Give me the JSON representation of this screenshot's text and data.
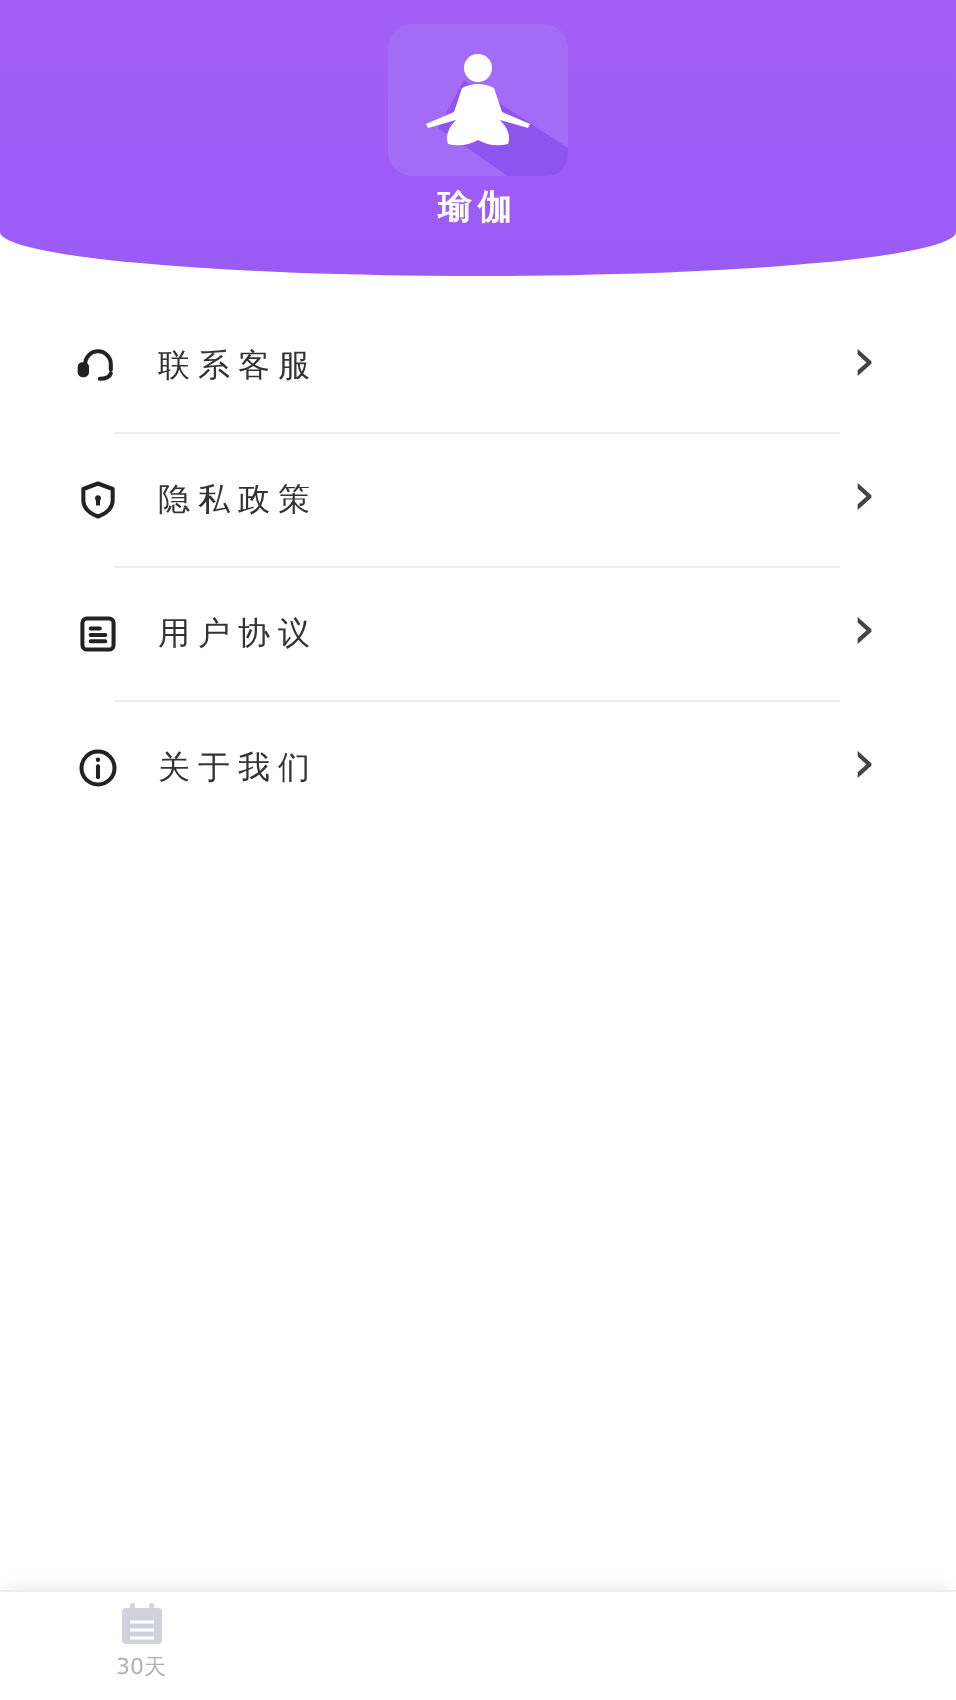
{
  "header": {
    "app_name": "瑜伽"
  },
  "menu": [
    {
      "kind": "headset",
      "label": "联系客服",
      "chevron": "›"
    },
    {
      "kind": "shield",
      "label": "隐私政策",
      "chevron": "›"
    },
    {
      "kind": "document",
      "label": "用户协议",
      "chevron": "›"
    },
    {
      "kind": "info",
      "label": "关于我们",
      "chevron": "›"
    }
  ],
  "tab_bar": {
    "tabs": [
      {
        "label": "30天",
        "selected": false
      }
    ]
  }
}
